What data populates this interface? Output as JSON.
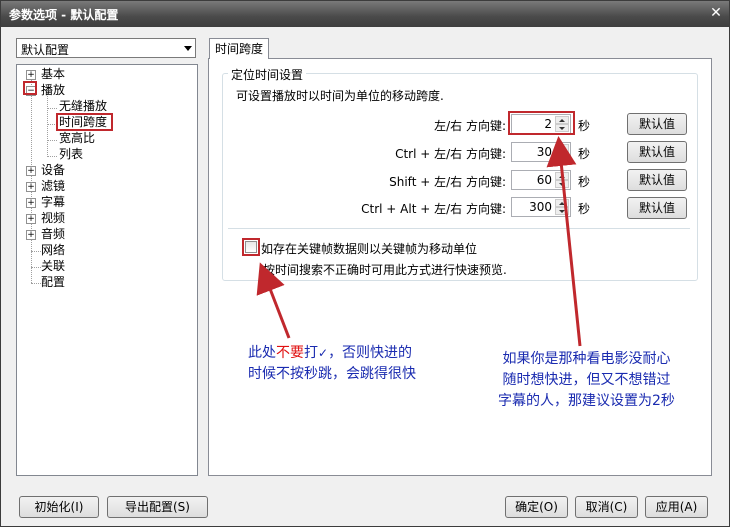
{
  "window": {
    "title": "参数选项 - 默认配置",
    "close_label": "✕"
  },
  "profile_combo": {
    "value": "默认配置"
  },
  "tree": {
    "items": [
      {
        "label": "基本",
        "expander": "+"
      },
      {
        "label": "播放",
        "expander": "−"
      },
      {
        "label": "无缝播放"
      },
      {
        "label": "时间跨度"
      },
      {
        "label": "宽高比"
      },
      {
        "label": "列表"
      },
      {
        "label": "设备",
        "expander": "+"
      },
      {
        "label": "滤镜",
        "expander": "+"
      },
      {
        "label": "字幕",
        "expander": "+"
      },
      {
        "label": "视频",
        "expander": "+"
      },
      {
        "label": "音频",
        "expander": "+"
      },
      {
        "label": "网络"
      },
      {
        "label": "关联"
      },
      {
        "label": "配置"
      }
    ]
  },
  "tab": {
    "label": "时间跨度"
  },
  "group": {
    "title": "定位时间设置",
    "description": "可设置播放时以时间为单位的移动跨度.",
    "rows": [
      {
        "label": "左/右 方向键:",
        "value": "2",
        "unit": "秒",
        "button": "默认值"
      },
      {
        "label": "Ctrl + 左/右 方向键:",
        "value": "30",
        "unit": "秒",
        "button": "默认值"
      },
      {
        "label": "Shift + 左/右 方向键:",
        "value": "60",
        "unit": "秒",
        "button": "默认值"
      },
      {
        "label": "Ctrl + Alt + 左/右 方向键:",
        "value": "300",
        "unit": "秒",
        "button": "默认值"
      }
    ],
    "checkbox_label": "如存在关键帧数据则以关键帧为移动单位",
    "checkbox_checked": false,
    "checkbox_hint": "按时间搜索不正确时可用此方式进行快速预览."
  },
  "annotations": {
    "left_line1_a": "此处",
    "left_line1_red": "不要",
    "left_line1_b": "打",
    "left_line1_c": "，否则快进的",
    "left_line2": "时候不按秒跳，会跳得很快",
    "right_line1": "如果你是那种看电影没耐心",
    "right_line2": "随时想快进，但又不想错过",
    "right_line3": "字幕的人，那建议设置为2秒"
  },
  "footer": {
    "reset": "初始化(I)",
    "export": "导出配置(S)",
    "ok": "确定(O)",
    "cancel": "取消(C)",
    "apply": "应用(A)"
  },
  "colors": {
    "highlight": "#c0282d",
    "annotation_text": "#1a2bb0",
    "annotation_emphasis": "#e01010"
  }
}
